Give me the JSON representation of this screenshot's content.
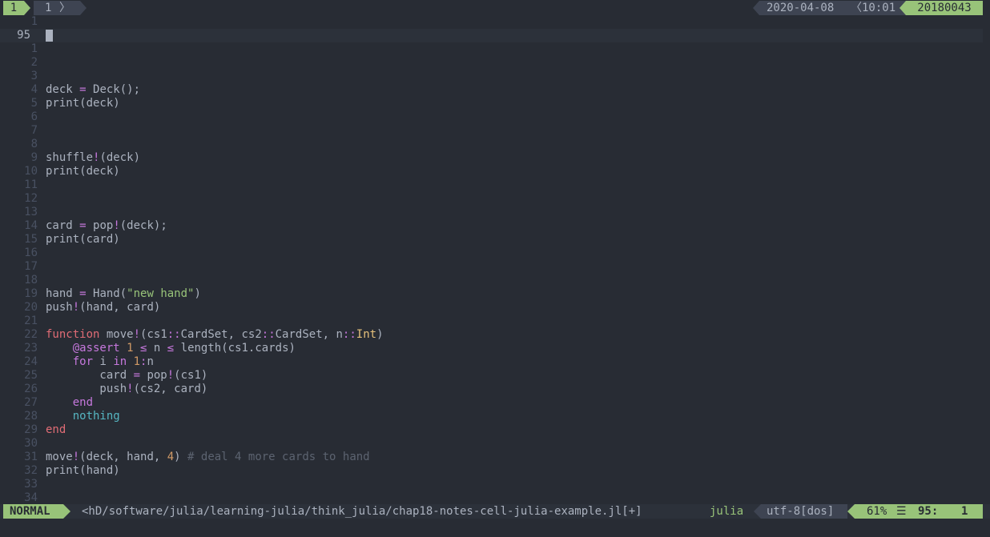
{
  "tabline": {
    "active_tab": "1",
    "buffer_number": "1",
    "date": "2020-04-08",
    "time": "10:01",
    "id": "20180043"
  },
  "editor": {
    "current_line_number": "95",
    "lines": [
      {
        "n": "1",
        "code": []
      },
      {
        "n": "95",
        "code": [],
        "current": true
      },
      {
        "n": "1",
        "code": []
      },
      {
        "n": "2",
        "code": []
      },
      {
        "n": "3",
        "code": []
      },
      {
        "n": "4",
        "code": [
          [
            "",
            "deck "
          ],
          [
            "op",
            "="
          ],
          [
            "",
            " Deck();"
          ]
        ]
      },
      {
        "n": "5",
        "code": [
          [
            "",
            "print(deck)"
          ]
        ]
      },
      {
        "n": "6",
        "code": []
      },
      {
        "n": "7",
        "code": []
      },
      {
        "n": "8",
        "code": []
      },
      {
        "n": "9",
        "code": [
          [
            "",
            "shuffle"
          ],
          [
            "op",
            "!"
          ],
          [
            "",
            "(deck)"
          ]
        ]
      },
      {
        "n": "10",
        "code": [
          [
            "",
            "print(deck)"
          ]
        ]
      },
      {
        "n": "11",
        "code": []
      },
      {
        "n": "12",
        "code": []
      },
      {
        "n": "13",
        "code": []
      },
      {
        "n": "14",
        "code": [
          [
            "",
            "card "
          ],
          [
            "op",
            "="
          ],
          [
            "",
            " pop"
          ],
          [
            "op",
            "!"
          ],
          [
            "",
            "(deck);"
          ]
        ]
      },
      {
        "n": "15",
        "code": [
          [
            "",
            "print(card)"
          ]
        ]
      },
      {
        "n": "16",
        "code": []
      },
      {
        "n": "17",
        "code": []
      },
      {
        "n": "18",
        "code": []
      },
      {
        "n": "19",
        "code": [
          [
            "",
            "hand "
          ],
          [
            "op",
            "="
          ],
          [
            "",
            " Hand("
          ],
          [
            "str",
            "\"new hand\""
          ],
          [
            "",
            ")"
          ]
        ]
      },
      {
        "n": "20",
        "code": [
          [
            "",
            "push"
          ],
          [
            "op",
            "!"
          ],
          [
            "",
            "(hand, card)"
          ]
        ]
      },
      {
        "n": "21",
        "code": []
      },
      {
        "n": "22",
        "code": [
          [
            "kw",
            "function"
          ],
          [
            "",
            " move"
          ],
          [
            "op",
            "!"
          ],
          [
            "",
            "(cs1"
          ],
          [
            "op",
            "::"
          ],
          [
            "",
            "CardSet, cs2"
          ],
          [
            "op",
            "::"
          ],
          [
            "",
            "CardSet, n"
          ],
          [
            "op",
            "::"
          ],
          [
            "typ",
            "Int"
          ],
          [
            "",
            ")"
          ]
        ]
      },
      {
        "n": "23",
        "code": [
          [
            "",
            "    "
          ],
          [
            "kw2",
            "@assert"
          ],
          [
            "",
            " "
          ],
          [
            "num",
            "1"
          ],
          [
            "",
            " "
          ],
          [
            "op",
            "≤"
          ],
          [
            "",
            " n "
          ],
          [
            "op",
            "≤"
          ],
          [
            "",
            " length(cs1.cards)"
          ]
        ]
      },
      {
        "n": "24",
        "code": [
          [
            "",
            "    "
          ],
          [
            "kw2",
            "for"
          ],
          [
            "",
            " i "
          ],
          [
            "kw2",
            "in"
          ],
          [
            "",
            " "
          ],
          [
            "num",
            "1"
          ],
          [
            "op",
            ":"
          ],
          [
            "",
            "n"
          ]
        ]
      },
      {
        "n": "25",
        "code": [
          [
            "",
            "        card "
          ],
          [
            "op",
            "="
          ],
          [
            "",
            " pop"
          ],
          [
            "op",
            "!"
          ],
          [
            "",
            "(cs1)"
          ]
        ]
      },
      {
        "n": "26",
        "code": [
          [
            "",
            "        push"
          ],
          [
            "op",
            "!"
          ],
          [
            "",
            "(cs2, card)"
          ]
        ]
      },
      {
        "n": "27",
        "code": [
          [
            "",
            "    "
          ],
          [
            "kw2",
            "end"
          ]
        ]
      },
      {
        "n": "28",
        "code": [
          [
            "",
            "    "
          ],
          [
            "cyan",
            "nothing"
          ]
        ]
      },
      {
        "n": "29",
        "code": [
          [
            "kw",
            "end"
          ]
        ]
      },
      {
        "n": "30",
        "code": []
      },
      {
        "n": "31",
        "code": [
          [
            "",
            "move"
          ],
          [
            "op",
            "!"
          ],
          [
            "",
            "(deck, hand, "
          ],
          [
            "num",
            "4"
          ],
          [
            "",
            ") "
          ],
          [
            "cmt",
            "# deal 4 more cards to hand"
          ]
        ]
      },
      {
        "n": "32",
        "code": [
          [
            "",
            "print(hand)"
          ]
        ]
      },
      {
        "n": "33",
        "code": []
      },
      {
        "n": "34",
        "code": []
      }
    ]
  },
  "statusline": {
    "mode": "NORMAL",
    "file": "<hD/software/julia/learning-julia/think_julia/chap18-notes-cell-julia-example.jl[+]",
    "filetype": "julia",
    "encoding": "utf-8[dos]",
    "percent": "61%",
    "menu_icon": "☰",
    "line": "95:",
    "col": "1"
  }
}
